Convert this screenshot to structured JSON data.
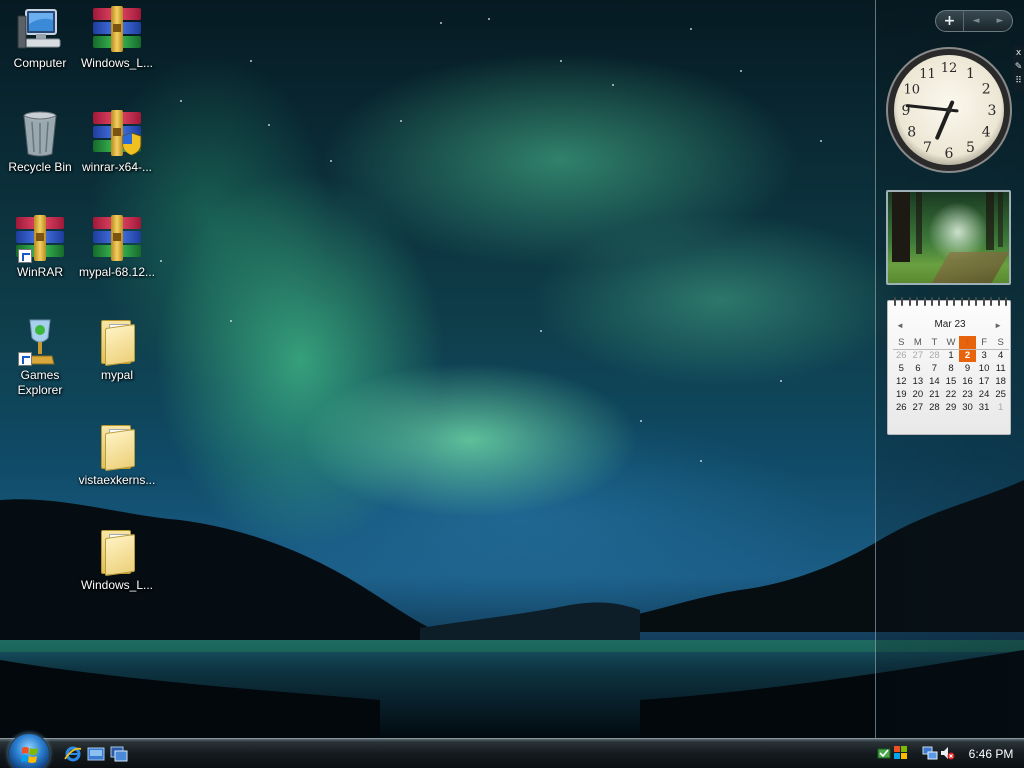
{
  "desktop": {
    "icons": [
      {
        "label": "Computer",
        "icon": "computer-icon"
      },
      {
        "label": "Windows_L...",
        "icon": "winrar-archive-icon"
      },
      {
        "label": "Recycle Bin",
        "icon": "recycle-bin-icon"
      },
      {
        "label": "winrar-x64-...",
        "icon": "winrar-installer-icon"
      },
      {
        "label": "WinRAR",
        "icon": "winrar-icon"
      },
      {
        "label": "mypal-68.12...",
        "icon": "winrar-archive-icon"
      },
      {
        "label": "Games Explorer",
        "icon": "games-explorer-icon"
      },
      {
        "label": "mypal",
        "icon": "folder-icon"
      },
      {
        "label": "vistaexkerns...",
        "icon": "folder-icon"
      },
      {
        "label": "Windows_L...",
        "icon": "folder-icon"
      }
    ]
  },
  "sidebar": {
    "controls": {
      "add": "+",
      "prev": "◄",
      "next": "►"
    },
    "handle": {
      "close": "x",
      "options": "✎",
      "drag": "⠿"
    },
    "clock": {
      "numerals": [
        "12",
        "1",
        "2",
        "3",
        "4",
        "5",
        "6",
        "7",
        "8",
        "9",
        "10",
        "11"
      ],
      "hour": 6,
      "minute": 46
    },
    "slideshow": {
      "image": "forest-path-photo"
    },
    "calendar": {
      "month": "Mar 23",
      "prev": "◄",
      "next": "►",
      "weekdays": [
        "S",
        "M",
        "T",
        "W",
        "T",
        "F",
        "S"
      ],
      "weeks": [
        [
          "26",
          "27",
          "28",
          "1",
          "2",
          "3",
          "4"
        ],
        [
          "5",
          "6",
          "7",
          "8",
          "9",
          "10",
          "11"
        ],
        [
          "12",
          "13",
          "14",
          "15",
          "16",
          "17",
          "18"
        ],
        [
          "19",
          "20",
          "21",
          "22",
          "23",
          "24",
          "25"
        ],
        [
          "26",
          "27",
          "28",
          "29",
          "30",
          "31",
          "1"
        ]
      ],
      "today": "2",
      "accent": "#e8640c"
    }
  },
  "taskbar": {
    "start": {
      "icon": "windows-start-orb-icon"
    },
    "quick_launch": [
      {
        "icon": "internet-explorer-icon"
      },
      {
        "icon": "show-desktop-icon"
      },
      {
        "icon": "switch-windows-icon"
      }
    ],
    "tray": {
      "icons": [
        "safely-remove-hardware-icon",
        "windows-update-icon",
        "network-icon",
        "volume-muted-icon"
      ],
      "time": "6:46 PM"
    }
  }
}
